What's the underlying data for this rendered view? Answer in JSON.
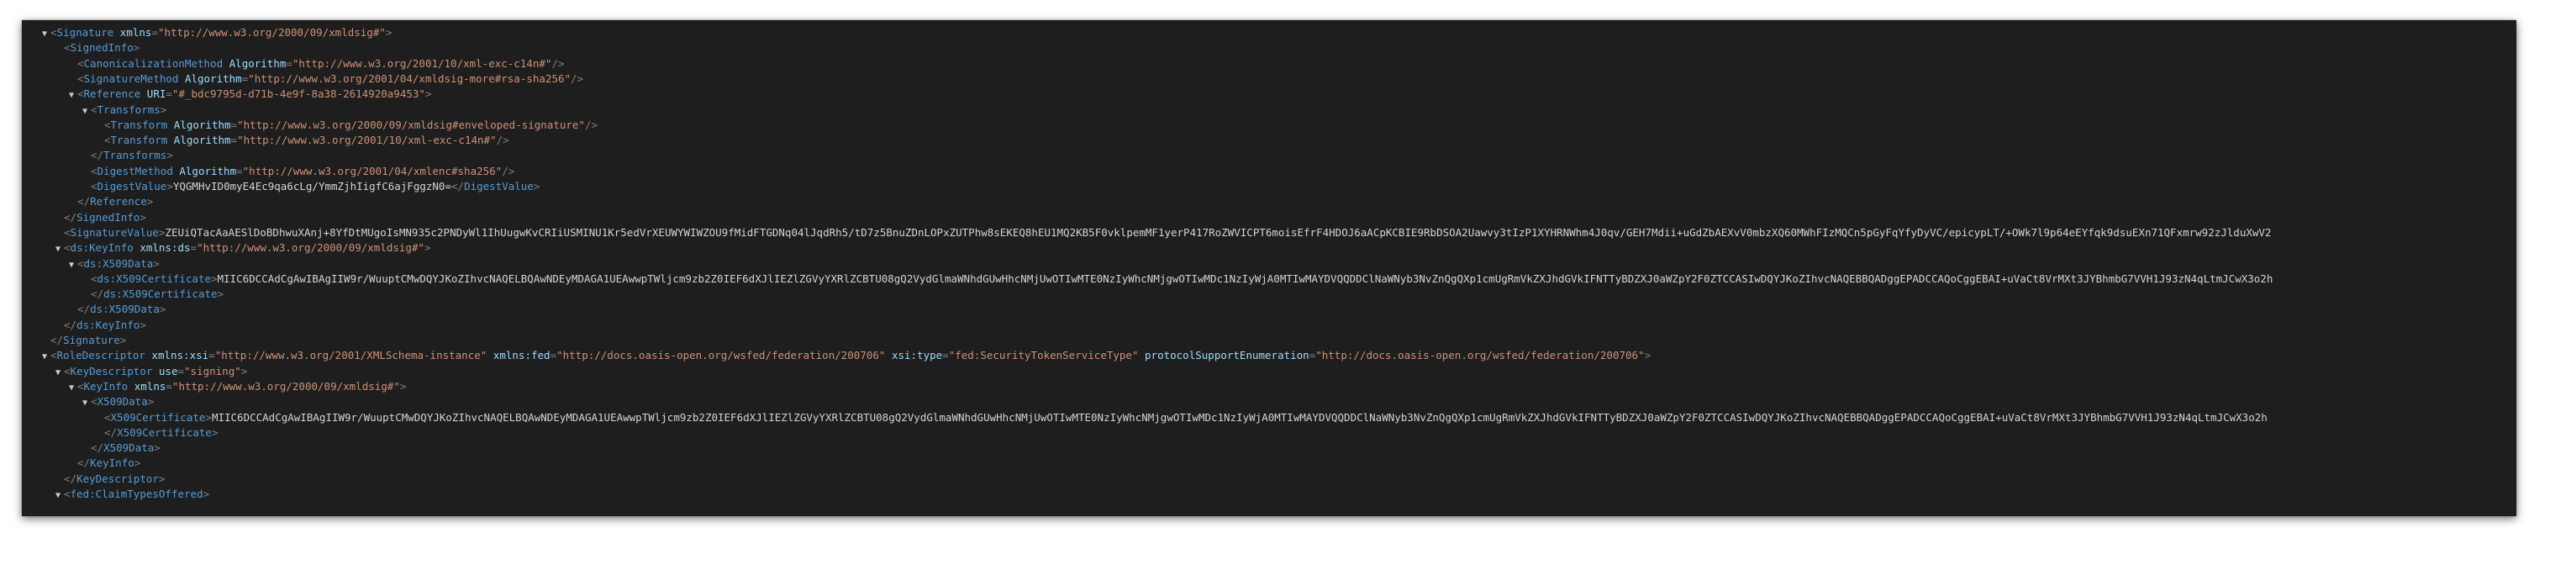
{
  "colors": {
    "background": "#1e1e1e",
    "punctuation": "#808080",
    "tag": "#569cd6",
    "attribute": "#9cdcfe",
    "value": "#ce9178",
    "text": "#d4d4d4"
  },
  "icons": {
    "expanded": "triangle-down-icon"
  },
  "lines": [
    {
      "indent": 0,
      "toggle": true,
      "tokens": [
        {
          "c": "p",
          "t": "<"
        },
        {
          "c": "t",
          "t": "Signature"
        },
        {
          "c": "x",
          "t": " "
        },
        {
          "c": "a",
          "t": "xmlns"
        },
        {
          "c": "p",
          "t": "="
        },
        {
          "c": "v",
          "t": "\"http://www.w3.org/2000/09/xmldsig#\""
        },
        {
          "c": "p",
          "t": ">"
        }
      ]
    },
    {
      "indent": 1,
      "toggle": false,
      "tokens": [
        {
          "c": "p",
          "t": "<"
        },
        {
          "c": "t",
          "t": "SignedInfo"
        },
        {
          "c": "p",
          "t": ">"
        }
      ]
    },
    {
      "indent": 2,
      "toggle": false,
      "tokens": [
        {
          "c": "p",
          "t": "<"
        },
        {
          "c": "t",
          "t": "CanonicalizationMethod"
        },
        {
          "c": "x",
          "t": " "
        },
        {
          "c": "a",
          "t": "Algorithm"
        },
        {
          "c": "p",
          "t": "="
        },
        {
          "c": "v",
          "t": "\"http://www.w3.org/2001/10/xml-exc-c14n#\""
        },
        {
          "c": "p",
          "t": "/>"
        }
      ]
    },
    {
      "indent": 2,
      "toggle": false,
      "tokens": [
        {
          "c": "p",
          "t": "<"
        },
        {
          "c": "t",
          "t": "SignatureMethod"
        },
        {
          "c": "x",
          "t": " "
        },
        {
          "c": "a",
          "t": "Algorithm"
        },
        {
          "c": "p",
          "t": "="
        },
        {
          "c": "v",
          "t": "\"http://www.w3.org/2001/04/xmldsig-more#rsa-sha256\""
        },
        {
          "c": "p",
          "t": "/>"
        }
      ]
    },
    {
      "indent": 2,
      "toggle": true,
      "tokens": [
        {
          "c": "p",
          "t": "<"
        },
        {
          "c": "t",
          "t": "Reference"
        },
        {
          "c": "x",
          "t": " "
        },
        {
          "c": "a",
          "t": "URI"
        },
        {
          "c": "p",
          "t": "="
        },
        {
          "c": "v",
          "t": "\"#_bdc9795d-d71b-4e9f-8a38-2614920a9453\""
        },
        {
          "c": "p",
          "t": ">"
        }
      ]
    },
    {
      "indent": 3,
      "toggle": true,
      "tokens": [
        {
          "c": "p",
          "t": "<"
        },
        {
          "c": "t",
          "t": "Transforms"
        },
        {
          "c": "p",
          "t": ">"
        }
      ]
    },
    {
      "indent": 4,
      "toggle": false,
      "tokens": [
        {
          "c": "p",
          "t": "<"
        },
        {
          "c": "t",
          "t": "Transform"
        },
        {
          "c": "x",
          "t": " "
        },
        {
          "c": "a",
          "t": "Algorithm"
        },
        {
          "c": "p",
          "t": "="
        },
        {
          "c": "v",
          "t": "\"http://www.w3.org/2000/09/xmldsig#enveloped-signature\""
        },
        {
          "c": "p",
          "t": "/>"
        }
      ]
    },
    {
      "indent": 4,
      "toggle": false,
      "tokens": [
        {
          "c": "p",
          "t": "<"
        },
        {
          "c": "t",
          "t": "Transform"
        },
        {
          "c": "x",
          "t": " "
        },
        {
          "c": "a",
          "t": "Algorithm"
        },
        {
          "c": "p",
          "t": "="
        },
        {
          "c": "v",
          "t": "\"http://www.w3.org/2001/10/xml-exc-c14n#\""
        },
        {
          "c": "p",
          "t": "/>"
        }
      ]
    },
    {
      "indent": 3,
      "toggle": false,
      "tokens": [
        {
          "c": "p",
          "t": "</"
        },
        {
          "c": "t",
          "t": "Transforms"
        },
        {
          "c": "p",
          "t": ">"
        }
      ]
    },
    {
      "indent": 3,
      "toggle": false,
      "tokens": [
        {
          "c": "p",
          "t": "<"
        },
        {
          "c": "t",
          "t": "DigestMethod"
        },
        {
          "c": "x",
          "t": " "
        },
        {
          "c": "a",
          "t": "Algorithm"
        },
        {
          "c": "p",
          "t": "="
        },
        {
          "c": "v",
          "t": "\"http://www.w3.org/2001/04/xmlenc#sha256\""
        },
        {
          "c": "p",
          "t": "/>"
        }
      ]
    },
    {
      "indent": 3,
      "toggle": false,
      "tokens": [
        {
          "c": "p",
          "t": "<"
        },
        {
          "c": "t",
          "t": "DigestValue"
        },
        {
          "c": "p",
          "t": ">"
        },
        {
          "c": "x",
          "t": "YQGMHvID0myE4Ec9qa6cLg/YmmZjhIigfC6ajFggzN0="
        },
        {
          "c": "p",
          "t": "</"
        },
        {
          "c": "t",
          "t": "DigestValue"
        },
        {
          "c": "p",
          "t": ">"
        }
      ]
    },
    {
      "indent": 2,
      "toggle": false,
      "tokens": [
        {
          "c": "p",
          "t": "</"
        },
        {
          "c": "t",
          "t": "Reference"
        },
        {
          "c": "p",
          "t": ">"
        }
      ]
    },
    {
      "indent": 1,
      "toggle": false,
      "tokens": [
        {
          "c": "p",
          "t": "</"
        },
        {
          "c": "t",
          "t": "SignedInfo"
        },
        {
          "c": "p",
          "t": ">"
        }
      ]
    },
    {
      "indent": 1,
      "toggle": false,
      "tokens": [
        {
          "c": "p",
          "t": "<"
        },
        {
          "c": "t",
          "t": "SignatureValue"
        },
        {
          "c": "p",
          "t": ">"
        },
        {
          "c": "x",
          "t": "ZEUiQTacAaAESlDoBDhwuXAnj+8YfDtMUgoIsMN935c2PNDyWl1IhUugwKvCRIiUSMINU1Kr5edVrXEUWYWIWZOU9fMidFTGDNq04lJqdRh5/tD7z5BnuZDnLOPxZUTPhw8sEKEQ8hEU1MQ2KB5F0vklpemMF1yerP417RoZWVICPT6moisEfrF4HDOJ6aACpKCBIE9RbDSOA2Uawvy3tIzP1XYHRNWhm4J0qv/GEH7Mdii+uGdZbAEXvV0mbzXQ60MWhFIzMQCn5pGyFqYfyDyVC/epicypLT/+OWk7l9p64eEYfqk9dsuEXn71QFxmrw92zJlduXwV2"
        }
      ]
    },
    {
      "indent": 1,
      "toggle": true,
      "tokens": [
        {
          "c": "p",
          "t": "<"
        },
        {
          "c": "t",
          "t": "ds:KeyInfo"
        },
        {
          "c": "x",
          "t": " "
        },
        {
          "c": "a",
          "t": "xmlns:ds"
        },
        {
          "c": "p",
          "t": "="
        },
        {
          "c": "v",
          "t": "\"http://www.w3.org/2000/09/xmldsig#\""
        },
        {
          "c": "p",
          "t": ">"
        }
      ]
    },
    {
      "indent": 2,
      "toggle": true,
      "tokens": [
        {
          "c": "p",
          "t": "<"
        },
        {
          "c": "t",
          "t": "ds:X509Data"
        },
        {
          "c": "p",
          "t": ">"
        }
      ]
    },
    {
      "indent": 3,
      "toggle": false,
      "tokens": [
        {
          "c": "p",
          "t": "<"
        },
        {
          "c": "t",
          "t": "ds:X509Certificate"
        },
        {
          "c": "p",
          "t": ">"
        },
        {
          "c": "x",
          "t": "MIIC6DCCAdCgAwIBAgIIW9r/WuuptCMwDQYJKoZIhvcNAQELBQAwNDEyMDAGA1UEAwwpTWljcm9zb2Z0IEF6dXJlIEZlZGVyYXRlZCBTU08gQ2VydGlmaWNhdGUwHhcNMjUwOTIwMTE0NzIyWhcNMjgwOTIwMDc1NzIyWjA0MTIwMAYDVQQDDClNaWNyb3NvZnQgQXp1cmUgRmVkZXJhdGVkIFNTTyBDZXJ0aWZpY2F0ZTCCASIwDQYJKoZIhvcNAQEBBQADggEPADCCAQoCggEBAI+uVaCt8VrMXt3JYBhmbG7VVH1J93zN4qLtmJCwX3o2h"
        }
      ]
    },
    {
      "indent": 3,
      "toggle": false,
      "tokens": [
        {
          "c": "p",
          "t": "</"
        },
        {
          "c": "t",
          "t": "ds:X509Certificate"
        },
        {
          "c": "p",
          "t": ">"
        }
      ]
    },
    {
      "indent": 2,
      "toggle": false,
      "tokens": [
        {
          "c": "p",
          "t": "</"
        },
        {
          "c": "t",
          "t": "ds:X509Data"
        },
        {
          "c": "p",
          "t": ">"
        }
      ]
    },
    {
      "indent": 1,
      "toggle": false,
      "tokens": [
        {
          "c": "p",
          "t": "</"
        },
        {
          "c": "t",
          "t": "ds:KeyInfo"
        },
        {
          "c": "p",
          "t": ">"
        }
      ]
    },
    {
      "indent": 0,
      "toggle": false,
      "tokens": [
        {
          "c": "p",
          "t": "</"
        },
        {
          "c": "t",
          "t": "Signature"
        },
        {
          "c": "p",
          "t": ">"
        }
      ]
    },
    {
      "indent": 0,
      "toggle": true,
      "tokens": [
        {
          "c": "p",
          "t": "<"
        },
        {
          "c": "t",
          "t": "RoleDescriptor"
        },
        {
          "c": "x",
          "t": " "
        },
        {
          "c": "a",
          "t": "xmlns:xsi"
        },
        {
          "c": "p",
          "t": "="
        },
        {
          "c": "v",
          "t": "\"http://www.w3.org/2001/XMLSchema-instance\""
        },
        {
          "c": "x",
          "t": " "
        },
        {
          "c": "a",
          "t": "xmlns:fed"
        },
        {
          "c": "p",
          "t": "="
        },
        {
          "c": "v",
          "t": "\"http://docs.oasis-open.org/wsfed/federation/200706\""
        },
        {
          "c": "x",
          "t": " "
        },
        {
          "c": "a",
          "t": "xsi:type"
        },
        {
          "c": "p",
          "t": "="
        },
        {
          "c": "v",
          "t": "\"fed:SecurityTokenServiceType\""
        },
        {
          "c": "x",
          "t": " "
        },
        {
          "c": "a",
          "t": "protocolSupportEnumeration"
        },
        {
          "c": "p",
          "t": "="
        },
        {
          "c": "v",
          "t": "\"http://docs.oasis-open.org/wsfed/federation/200706\""
        },
        {
          "c": "p",
          "t": ">"
        }
      ]
    },
    {
      "indent": 1,
      "toggle": true,
      "tokens": [
        {
          "c": "p",
          "t": "<"
        },
        {
          "c": "t",
          "t": "KeyDescriptor"
        },
        {
          "c": "x",
          "t": " "
        },
        {
          "c": "a",
          "t": "use"
        },
        {
          "c": "p",
          "t": "="
        },
        {
          "c": "v",
          "t": "\"signing\""
        },
        {
          "c": "p",
          "t": ">"
        }
      ]
    },
    {
      "indent": 2,
      "toggle": true,
      "tokens": [
        {
          "c": "p",
          "t": "<"
        },
        {
          "c": "t",
          "t": "KeyInfo"
        },
        {
          "c": "x",
          "t": " "
        },
        {
          "c": "a",
          "t": "xmlns"
        },
        {
          "c": "p",
          "t": "="
        },
        {
          "c": "v",
          "t": "\"http://www.w3.org/2000/09/xmldsig#\""
        },
        {
          "c": "p",
          "t": ">"
        }
      ]
    },
    {
      "indent": 3,
      "toggle": true,
      "tokens": [
        {
          "c": "p",
          "t": "<"
        },
        {
          "c": "t",
          "t": "X509Data"
        },
        {
          "c": "p",
          "t": ">"
        }
      ]
    },
    {
      "indent": 4,
      "toggle": false,
      "tokens": [
        {
          "c": "p",
          "t": "<"
        },
        {
          "c": "t",
          "t": "X509Certificate"
        },
        {
          "c": "p",
          "t": ">"
        },
        {
          "c": "x",
          "t": "MIIC6DCCAdCgAwIBAgIIW9r/WuuptCMwDQYJKoZIhvcNAQELBQAwNDEyMDAGA1UEAwwpTWljcm9zb2Z0IEF6dXJlIEZlZGVyYXRlZCBTU08gQ2VydGlmaWNhdGUwHhcNMjUwOTIwMTE0NzIyWhcNMjgwOTIwMDc1NzIyWjA0MTIwMAYDVQQDDClNaWNyb3NvZnQgQXp1cmUgRmVkZXJhdGVkIFNTTyBDZXJ0aWZpY2F0ZTCCASIwDQYJKoZIhvcNAQEBBQADggEPADCCAQoCggEBAI+uVaCt8VrMXt3JYBhmbG7VVH1J93zN4qLtmJCwX3o2h"
        }
      ]
    },
    {
      "indent": 4,
      "toggle": false,
      "tokens": [
        {
          "c": "p",
          "t": "</"
        },
        {
          "c": "t",
          "t": "X509Certificate"
        },
        {
          "c": "p",
          "t": ">"
        }
      ]
    },
    {
      "indent": 3,
      "toggle": false,
      "tokens": [
        {
          "c": "p",
          "t": "</"
        },
        {
          "c": "t",
          "t": "X509Data"
        },
        {
          "c": "p",
          "t": ">"
        }
      ]
    },
    {
      "indent": 2,
      "toggle": false,
      "tokens": [
        {
          "c": "p",
          "t": "</"
        },
        {
          "c": "t",
          "t": "KeyInfo"
        },
        {
          "c": "p",
          "t": ">"
        }
      ]
    },
    {
      "indent": 1,
      "toggle": false,
      "tokens": [
        {
          "c": "p",
          "t": "</"
        },
        {
          "c": "t",
          "t": "KeyDescriptor"
        },
        {
          "c": "p",
          "t": ">"
        }
      ]
    },
    {
      "indent": 1,
      "toggle": true,
      "tokens": [
        {
          "c": "p",
          "t": "<"
        },
        {
          "c": "t",
          "t": "fed:ClaimTypesOffered"
        },
        {
          "c": "p",
          "t": ">"
        }
      ]
    }
  ]
}
